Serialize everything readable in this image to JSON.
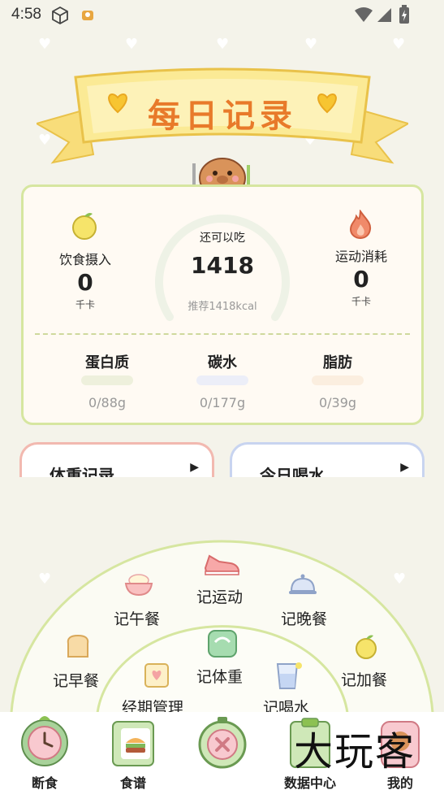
{
  "status_bar": {
    "time": "4:58"
  },
  "banner": {
    "title": "每日记录"
  },
  "summary": {
    "intake_label": "饮食摄入",
    "intake_value": "0",
    "intake_unit": "千卡",
    "remain_label": "还可以吃",
    "remain_value": "1418",
    "remain_recommend": "推荐1418kcal",
    "burn_label": "运动消耗",
    "burn_value": "0",
    "burn_unit": "千卡",
    "remaining_fraction": 1.0
  },
  "macros": [
    {
      "name": "蛋白质",
      "value": "0/88g",
      "color": "#eef0dc"
    },
    {
      "name": "碳水",
      "value": "0/177g",
      "color": "#eceef8"
    },
    {
      "name": "脂肪",
      "value": "0/39g",
      "color": "#fbeedf"
    }
  ],
  "cards": {
    "weight": "体重记录",
    "water": "今日喝水"
  },
  "actions": {
    "lunch": "记午餐",
    "exercise": "记运动",
    "dinner": "记晚餐",
    "breakfast": "记早餐",
    "weight": "记体重",
    "extra_meal": "记加餐",
    "period": "经期管理",
    "water": "记喝水"
  },
  "tabs": {
    "fasting": "断食",
    "recipes": "食谱",
    "data": "数据中心",
    "mine": "我的"
  },
  "watermark": "大玩客",
  "colors": {
    "accent_orange": "#e87a2a",
    "card_border": "#d6e6a0",
    "weight_card": "#f2b9b0",
    "water_card": "#c8d4f0"
  }
}
